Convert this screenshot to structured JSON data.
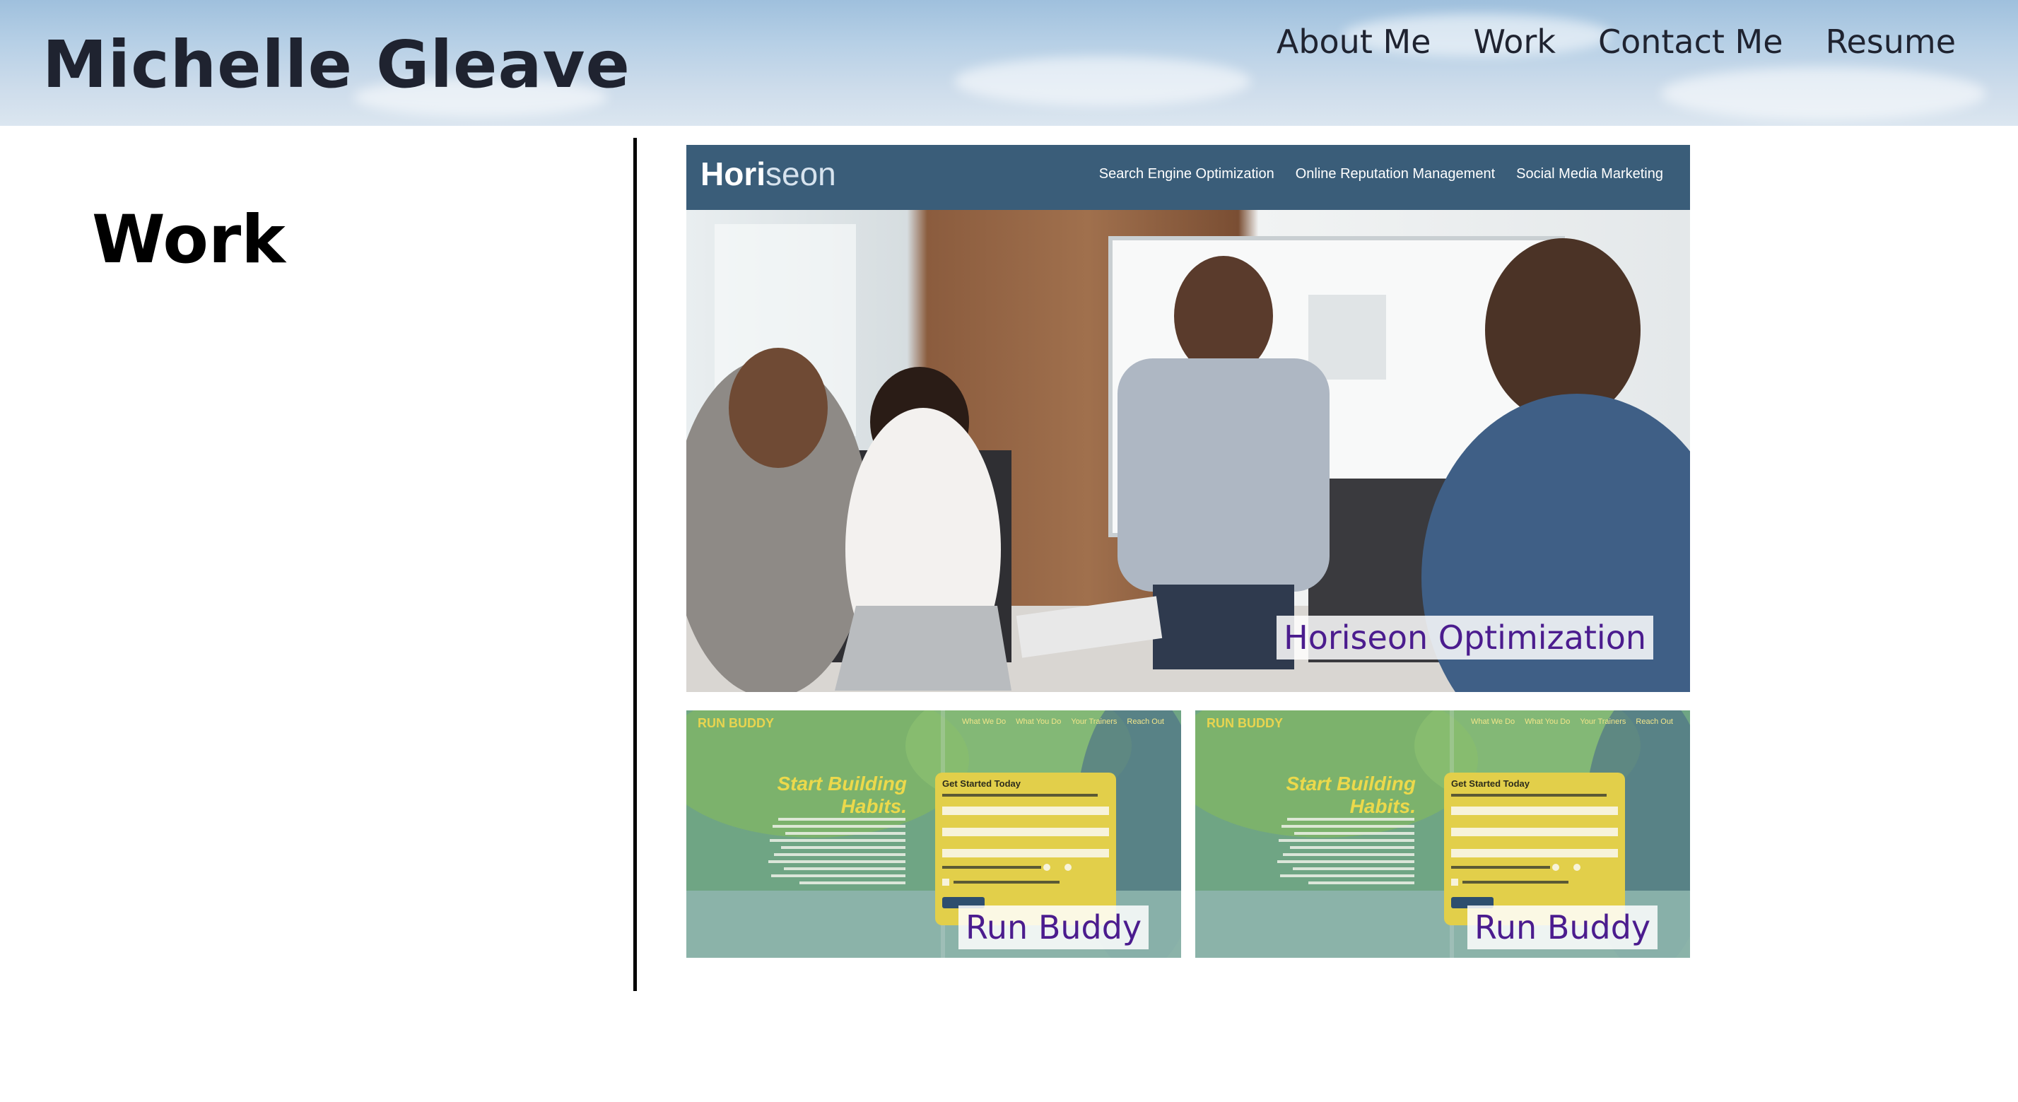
{
  "header": {
    "title": "Michelle Gleave",
    "nav": [
      "About Me",
      "Work",
      "Contact Me",
      "Resume"
    ]
  },
  "main": {
    "heading": "Work"
  },
  "projects": [
    {
      "caption": "Horiseon Optimization",
      "screenshot": {
        "logo_bold": "Hori",
        "logo_light": "seon",
        "nav": [
          "Search Engine Optimization",
          "Online Reputation Management",
          "Social Media Marketing"
        ]
      }
    },
    {
      "caption": "Run Buddy",
      "screenshot": {
        "brand": "RUN BUDDY",
        "nav": [
          "What We Do",
          "What You Do",
          "Your Trainers",
          "Reach Out"
        ],
        "headline_1": "Start Building",
        "headline_2": "Habits.",
        "form_title": "Get Started Today"
      }
    },
    {
      "caption": "Run Buddy",
      "screenshot": {
        "brand": "RUN BUDDY",
        "nav": [
          "What We Do",
          "What You Do",
          "Your Trainers",
          "Reach Out"
        ],
        "headline_1": "Start Building",
        "headline_2": "Habits.",
        "form_title": "Get Started Today"
      }
    }
  ],
  "colors": {
    "title_text": "#1f2330",
    "caption_text": "#4b1c8e",
    "horiseon_bar": "#3a5d79",
    "runbuddy_yellow": "#e2cf4a"
  }
}
